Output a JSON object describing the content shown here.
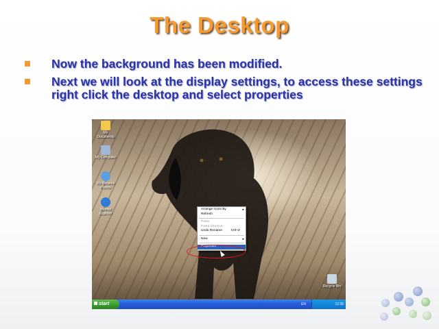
{
  "slide": {
    "title": "The Desktop",
    "bullets": [
      "Now the background has been modified.",
      "Next we will look at the display settings, to access these settings right click the desktop and select properties"
    ]
  },
  "desktop": {
    "icons": [
      {
        "label": "My Documents",
        "icon": "folder-icon",
        "color": "#f2c94c"
      },
      {
        "label": "My Computer",
        "icon": "computer-icon",
        "color": "#9fb6d9"
      },
      {
        "label": "My Network Places",
        "icon": "network-icon",
        "color": "#5aa0e0"
      },
      {
        "label": "Internet Explorer",
        "icon": "ie-icon",
        "color": "#2f7bd6"
      },
      {
        "label": "Recycle Bin",
        "icon": "recycle-bin-icon",
        "color": "#c9d6e3"
      }
    ],
    "context_menu": {
      "items": [
        {
          "label": "Arrange Icons By",
          "arrow": "▸"
        },
        {
          "label": "Refresh"
        },
        {
          "label": "Paste"
        },
        {
          "label": "Paste Shortcut"
        },
        {
          "label": "Undo Rename",
          "shortcut": "Ctrl+Z"
        },
        {
          "label": "New",
          "arrow": "▸"
        },
        {
          "label": "Properties"
        }
      ]
    },
    "taskbar": {
      "start_label": "start",
      "language": "EN",
      "tray_time": "12:35"
    }
  },
  "colors": {
    "title": "#f59a32",
    "bullet_text": "#2b33a8",
    "bullet_mark": "#f59a32",
    "highlight": "#e0161b"
  }
}
